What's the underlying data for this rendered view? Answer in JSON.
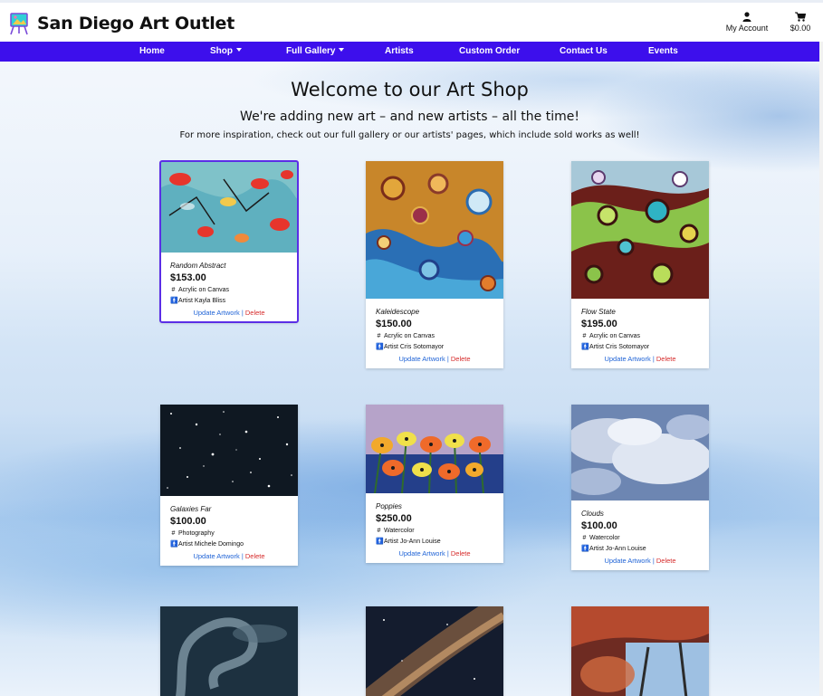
{
  "header": {
    "brand": "San Diego Art Outlet",
    "account_label": "My Account",
    "cart_total": "$0.00"
  },
  "nav": {
    "items": [
      {
        "label": "Home",
        "dropdown": false
      },
      {
        "label": "Shop",
        "dropdown": true
      },
      {
        "label": "Full Gallery",
        "dropdown": true
      },
      {
        "label": "Artists",
        "dropdown": false
      },
      {
        "label": "Custom Order",
        "dropdown": false
      },
      {
        "label": "Contact Us",
        "dropdown": false
      },
      {
        "label": "Events",
        "dropdown": false
      }
    ]
  },
  "hero": {
    "title": "Welcome to our Art Shop",
    "subtitle": "We're adding new art – and new artists – all the time!",
    "note": "For more inspiration, check out our full gallery or our artists' pages, which include sold works as well!"
  },
  "labels": {
    "artist_prefix": "Artist",
    "update": "Update Artwork",
    "separator": "|",
    "delete": "Delete",
    "medium_icon": "#",
    "artist_icon": "person-icon"
  },
  "artworks": [
    {
      "title": "Random Abstract",
      "price": "$153.00",
      "medium": "Acrylic on Canvas",
      "artist": "Kayla Bliss"
    },
    {
      "title": "Kaleidescope",
      "price": "$150.00",
      "medium": "Acrylic on Canvas",
      "artist": "Cris Sotomayor"
    },
    {
      "title": "Flow State",
      "price": "$195.00",
      "medium": "Acrylic on Canvas",
      "artist": "Cris Sotomayor"
    },
    {
      "title": "Galaxies Far",
      "price": "$100.00",
      "medium": "Photography",
      "artist": "Michele Domingo"
    },
    {
      "title": "Poppies",
      "price": "$250.00",
      "medium": "Watercolor",
      "artist": "Jo-Ann Louise"
    },
    {
      "title": "Clouds",
      "price": "$100.00",
      "medium": "Watercolor",
      "artist": "Jo-Ann Louise"
    }
  ],
  "colors": {
    "nav_bg": "#3d0fec",
    "link_blue": "#1f63d6",
    "delete_red": "#d62b2b",
    "selected_outline": "#5b2ee6"
  }
}
